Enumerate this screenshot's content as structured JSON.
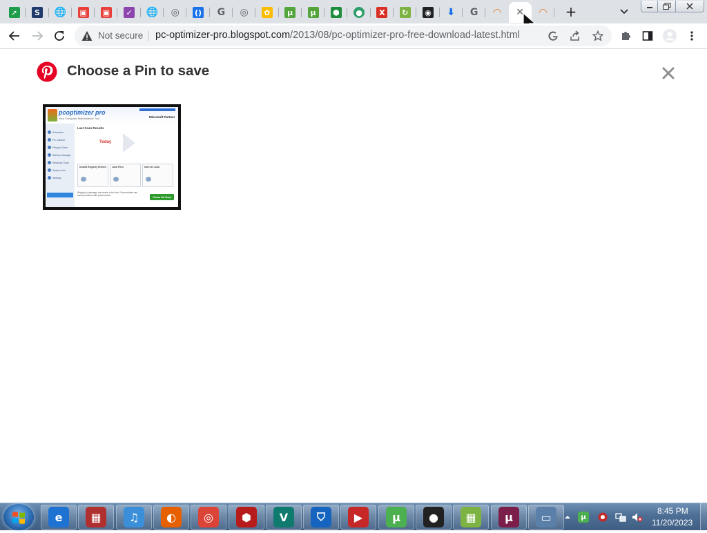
{
  "browser": {
    "tabs": [
      {
        "icon": "green-arrow-icon",
        "color": "#1e9e4a",
        "glyph": "➚"
      },
      {
        "icon": "s-logo-icon",
        "color": "#1f3a6b",
        "glyph": "S"
      },
      {
        "icon": "globe-icon",
        "color": "#5f6368",
        "glyph": "🌐"
      },
      {
        "icon": "colorful-app-icon",
        "color": "#e8413c",
        "glyph": "▣"
      },
      {
        "icon": "colorful-app-icon",
        "color": "#e8413c",
        "glyph": "▣"
      },
      {
        "icon": "purple-check-icon",
        "color": "#8e44ad",
        "glyph": "✓"
      },
      {
        "icon": "globe-icon",
        "color": "#5f6368",
        "glyph": "🌐"
      },
      {
        "icon": "chrome-icon",
        "color": "#5f6368",
        "glyph": "◎"
      },
      {
        "icon": "blue-bracket-icon",
        "color": "#1a73e8",
        "glyph": "()"
      },
      {
        "icon": "google-g-icon",
        "color": "#5f6368",
        "glyph": "G"
      },
      {
        "icon": "chrome-icon",
        "color": "#5f6368",
        "glyph": "◎"
      },
      {
        "icon": "google-photos-icon",
        "color": "#fbbc04",
        "glyph": "✿"
      },
      {
        "icon": "utorrent-icon",
        "color": "#53a53c",
        "glyph": "µ"
      },
      {
        "icon": "utorrent-icon",
        "color": "#53a53c",
        "glyph": "µ"
      },
      {
        "icon": "green-shield-icon",
        "color": "#1e8e3e",
        "glyph": "⬢"
      },
      {
        "icon": "earth-icon",
        "color": "#2e9e6b",
        "glyph": "●"
      },
      {
        "icon": "red-x-icon",
        "color": "#d93025",
        "glyph": "X"
      },
      {
        "icon": "green-swirl-icon",
        "color": "#7cb342",
        "glyph": "↻"
      },
      {
        "icon": "black-circle-icon",
        "color": "#202124",
        "glyph": "◉"
      },
      {
        "icon": "download-icon",
        "color": "#1a73e8",
        "glyph": "⬇"
      },
      {
        "icon": "google-g-icon",
        "color": "#5f6368",
        "glyph": "G"
      },
      {
        "icon": "rainbow-icon",
        "color": "#e8710a",
        "glyph": "◠"
      },
      {
        "icon": "close-tab-icon",
        "color": "#5f6368",
        "glyph": "✕",
        "active": true
      },
      {
        "icon": "rainbow-icon",
        "color": "#e8710a",
        "glyph": "◠"
      }
    ],
    "new_tab_label": "+",
    "security_label": "Not secure",
    "url_host": "pc-optimizer-pro.blogspot.com",
    "url_path": "/2013/08/pc-optimizer-pro-free-download-latest.html"
  },
  "dialog": {
    "title": "Choose a Pin to save",
    "brand_color": "#e60023"
  },
  "thumbnail": {
    "app_title": "pcoptimizer pro",
    "app_subtitle": "Your Computer Maintenance Tool",
    "partner": "Microsoft Partner",
    "heading": "Last Scan Results",
    "today": "Today",
    "sidebar": [
      "Scheduler",
      "PC Cleaner",
      "Privacy Clean",
      "Startup Manager",
      "Windows Tools",
      "System Info",
      "Settings"
    ],
    "cards": [
      "Invalid Registry Entries",
      "Junk Files",
      "Internet Junk"
    ],
    "footer": "Registry is damaged and needs to be fixed. Some entries can cause problems with performance.",
    "clean_button": "Clean All Now"
  },
  "taskbar": {
    "apps": [
      {
        "icon": "internet-explorer-icon",
        "color": "#1e73d2",
        "glyph": "e"
      },
      {
        "icon": "media-app-icon",
        "color": "#b03030",
        "glyph": "▦"
      },
      {
        "icon": "itunes-icon",
        "color": "#3b8fd9",
        "glyph": "♫"
      },
      {
        "icon": "firefox-icon",
        "color": "#e66000",
        "glyph": "◐"
      },
      {
        "icon": "chrome-icon",
        "color": "#db4437",
        "glyph": "◎"
      },
      {
        "icon": "shield-app-icon",
        "color": "#b71c1c",
        "glyph": "⬢"
      },
      {
        "icon": "vpn-v-icon",
        "color": "#0f7a6e",
        "glyph": "V"
      },
      {
        "icon": "blue-shield-icon",
        "color": "#1565c0",
        "glyph": "⛉"
      },
      {
        "icon": "video-recorder-icon",
        "color": "#c62828",
        "glyph": "▶"
      },
      {
        "icon": "utorrent-icon",
        "color": "#4caf50",
        "glyph": "µ"
      },
      {
        "icon": "black-pot-icon",
        "color": "#212121",
        "glyph": "●"
      },
      {
        "icon": "color-grid-icon",
        "color": "#7cb342",
        "glyph": "▦"
      },
      {
        "icon": "utorrent-icon",
        "color": "#7b1f4a",
        "glyph": "µ"
      },
      {
        "icon": "screen-app-icon",
        "color": "#5a7fa8",
        "glyph": "▭"
      }
    ],
    "clock_time": "8:45 PM",
    "clock_date": "11/20/2023"
  }
}
